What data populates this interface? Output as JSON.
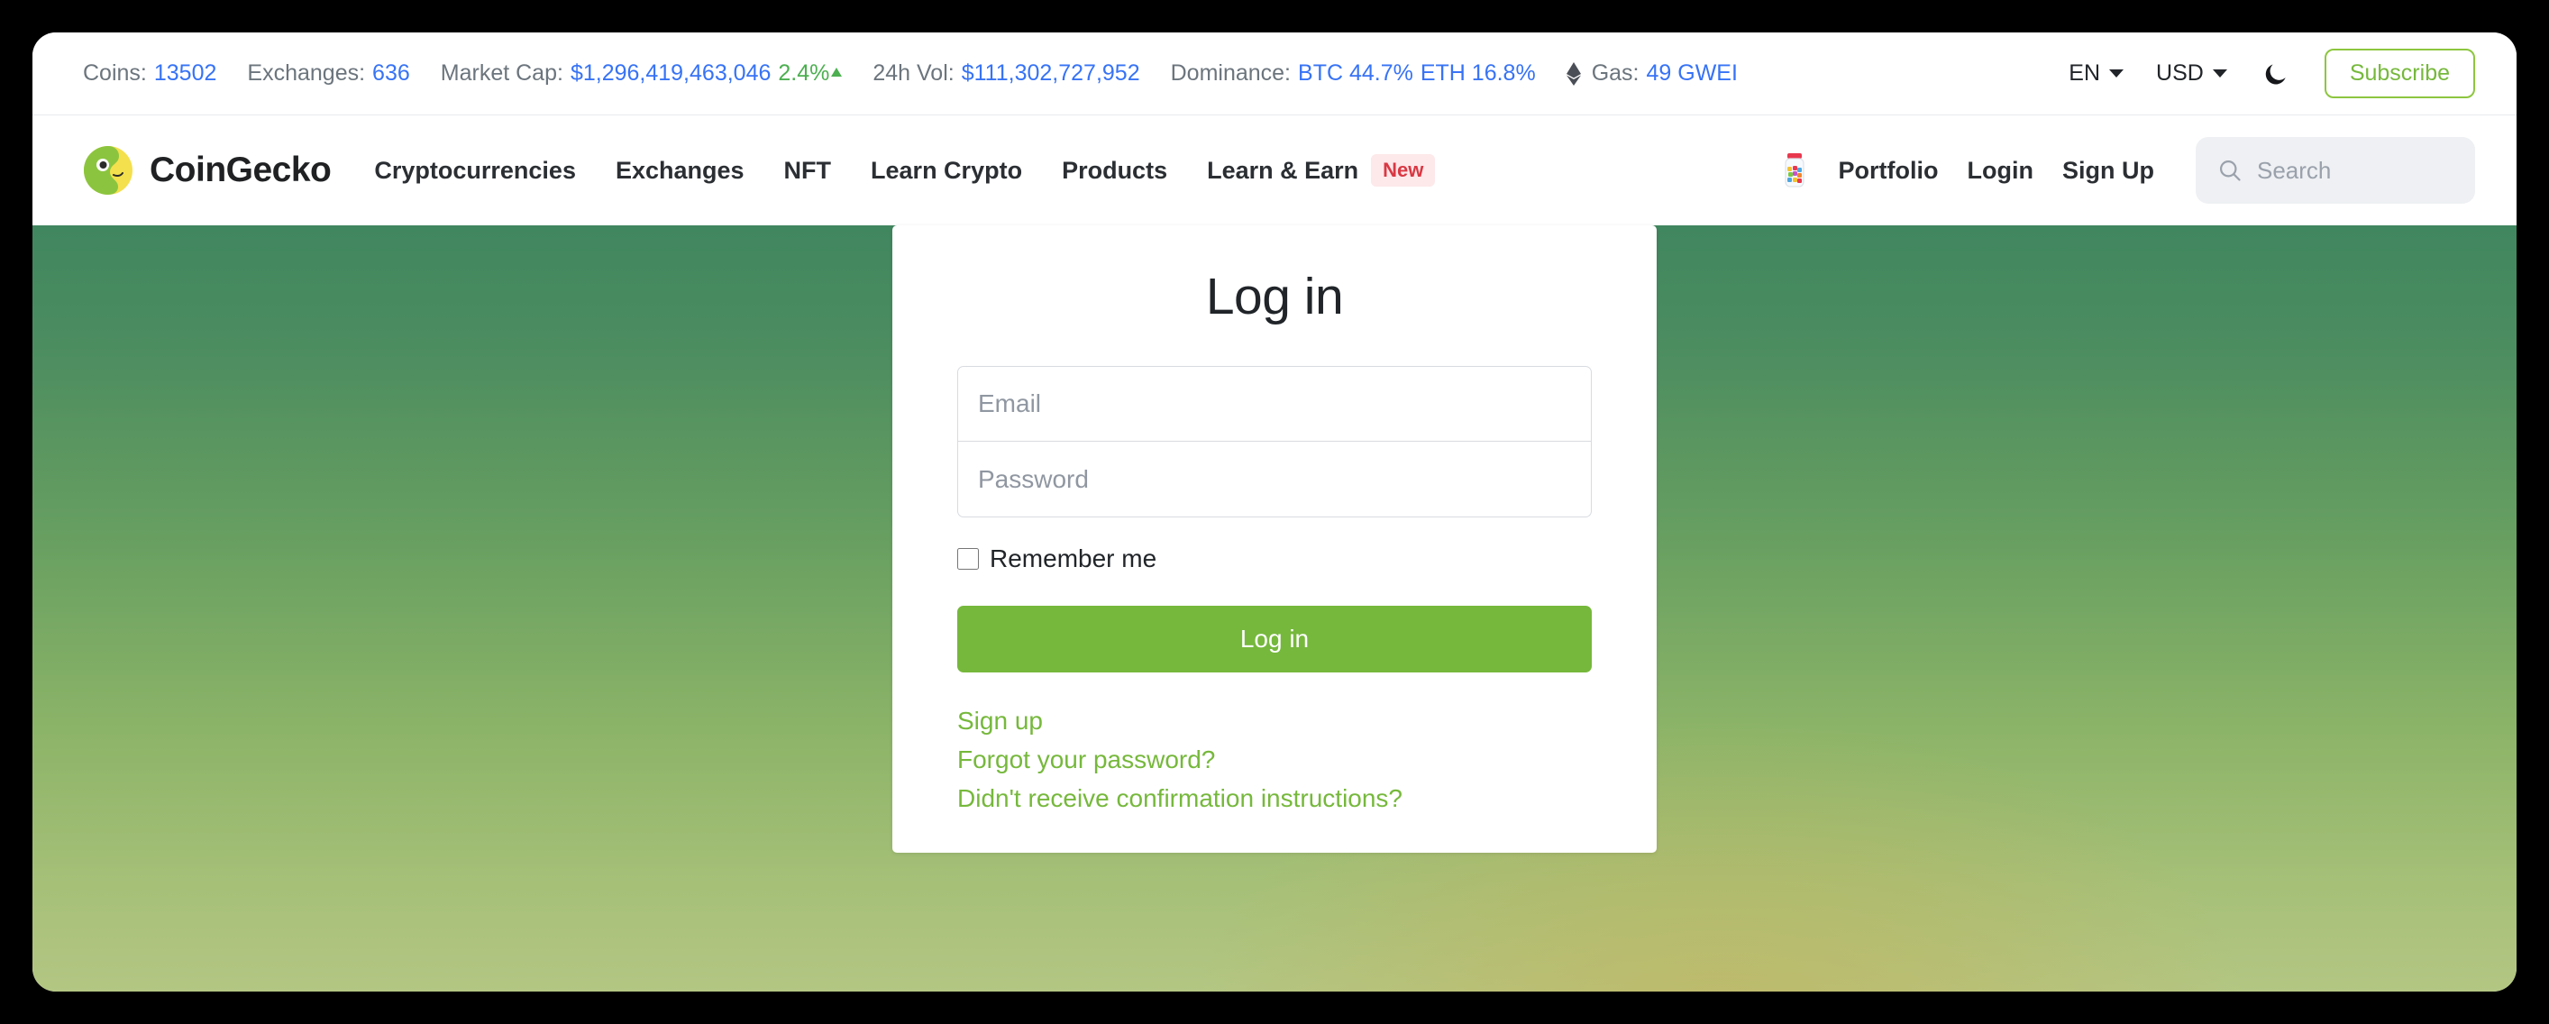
{
  "ticker": {
    "items": [
      {
        "name": "coins",
        "label": "Coins:",
        "value": "13502"
      },
      {
        "name": "exchanges",
        "label": "Exchanges:",
        "value": "636"
      },
      {
        "name": "market-cap",
        "label": "Market Cap:",
        "value": "$1,296,419,463,046",
        "change": "2.4%",
        "direction": "up"
      },
      {
        "name": "vol-24h",
        "label": "24h Vol:",
        "value": "$111,302,727,952"
      },
      {
        "name": "dominance",
        "label": "Dominance:",
        "value": "BTC 44.7%",
        "value2": "ETH 16.8%"
      },
      {
        "name": "gas",
        "label": "Gas:",
        "value": "49 GWEI",
        "icon": "ethereum-icon"
      }
    ],
    "language": "EN",
    "currency": "USD",
    "theme_toggle_icon": "moon-icon",
    "subscribe_label": "Subscribe"
  },
  "nav": {
    "logo_icon": "coingecko-gecko-icon",
    "brand": "CoinGecko",
    "links": [
      {
        "label": "Cryptocurrencies"
      },
      {
        "label": "Exchanges"
      },
      {
        "label": "NFT"
      },
      {
        "label": "Learn Crypto"
      },
      {
        "label": "Products"
      },
      {
        "label": "Learn & Earn",
        "badge": "New"
      }
    ],
    "portfolio_icon": "candy-jar-icon",
    "portfolio": "Portfolio",
    "login": "Login",
    "signup": "Sign Up",
    "search_icon": "search-icon",
    "search_placeholder": "Search"
  },
  "login_card": {
    "title": "Log in",
    "email_placeholder": "Email",
    "email_value": "",
    "password_placeholder": "Password",
    "password_value": "",
    "remember_label": "Remember me",
    "remember_checked": false,
    "submit_label": "Log in",
    "links": [
      {
        "label": "Sign up"
      },
      {
        "label": "Forgot your password?"
      },
      {
        "label": "Didn't receive confirmation instructions?"
      }
    ]
  },
  "colors": {
    "brand_green": "#76b83c",
    "accent_blue": "#3773f5",
    "up_green": "#4caf50",
    "badge_red": "#d93843",
    "badge_red_bg": "#fde8ea"
  }
}
